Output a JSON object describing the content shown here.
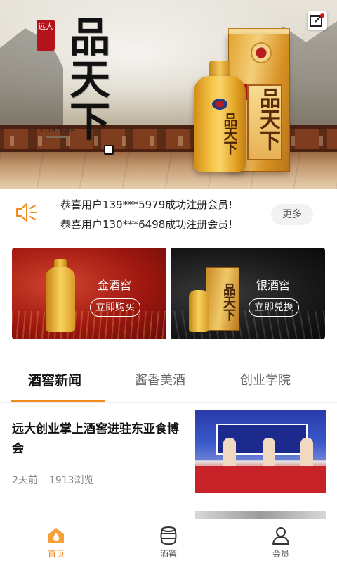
{
  "hero": {
    "seal_text": "远大",
    "title": "品天下",
    "brand_en": "YUANDA",
    "box_text": "品天下",
    "bottle_text": "品天下"
  },
  "notice": {
    "messages": [
      "恭喜用户139***5979成功注册会员!",
      "恭喜用户130***6498成功注册会员!"
    ],
    "more_label": "更多"
  },
  "cards": {
    "gold": {
      "title": "金酒窖",
      "cta": "立即购买"
    },
    "silver": {
      "title": "银酒窖",
      "cta": "立即兑换",
      "box_text": "品天下"
    }
  },
  "tabs": [
    {
      "label": "酒窖新闻",
      "active": true
    },
    {
      "label": "酱香美酒",
      "active": false
    },
    {
      "label": "创业学院",
      "active": false
    }
  ],
  "news": [
    {
      "title": "远大创业掌上酒窖进驻东亚食博会",
      "age": "2天前",
      "views": "1913浏览"
    }
  ],
  "bottom_nav": [
    {
      "label": "首页",
      "icon": "home-icon",
      "active": true
    },
    {
      "label": "酒窖",
      "icon": "barrel-icon",
      "active": false
    },
    {
      "label": "会员",
      "icon": "user-icon",
      "active": false
    }
  ],
  "colors": {
    "accent": "#f08a1d",
    "speaker": "#f08a1d"
  }
}
